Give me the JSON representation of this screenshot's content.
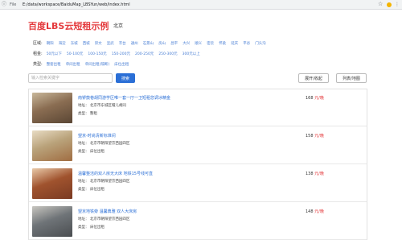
{
  "browser": {
    "file_label": "File",
    "url": "E:/data/workspace/BaiduMap_LBSYun/web/index.html"
  },
  "header": {
    "title": "百度LBS云短租示例",
    "city": "北京"
  },
  "filters": {
    "district": {
      "label": "区域:",
      "options": [
        "朝阳",
        "海淀",
        "东城",
        "西城",
        "崇文",
        "宣武",
        "丰台",
        "通州",
        "石景山",
        "房山",
        "昌平",
        "大兴",
        "顺义",
        "密云",
        "怀柔",
        "延庆",
        "平谷",
        "门头沟"
      ]
    },
    "rent": {
      "label": "租金:",
      "options": [
        "50元以下",
        "50-100元",
        "100-150元",
        "150-200元",
        "200-250元",
        "250-300元",
        "300元以上"
      ]
    },
    "type": {
      "label": "类型:",
      "options": [
        "整套出租",
        "单间出租",
        "单间出租(隔断)",
        "床位出租"
      ]
    }
  },
  "search": {
    "placeholder": "输入检索关键字",
    "button": "搜索",
    "toggle": "展开/收起",
    "list_map": "列表/地图"
  },
  "listings": [
    {
      "title": "南锣鼓巷胡同游学区唯一套一厅一卫短租您调冰精金",
      "address": "地址：  北京市东城区帽儿胡同",
      "type": "类型：  整租",
      "price": "168",
      "unit": "元/晚",
      "thumb_colors": [
        "#8a6d52",
        "#c9b89b",
        "#5a4634"
      ]
    },
    {
      "title": "望京-时尚清新标准间",
      "address": "地址：  北京市朝阳望京西园四区",
      "type": "类型：  床位出租",
      "price": "158",
      "unit": "元/晚",
      "thumb_colors": [
        "#b9a27a",
        "#e8dcc4",
        "#a06d42"
      ]
    },
    {
      "title": "温馨整洁的双人房无大床 地铁15号线可直",
      "address": "地址：  北京市朝阳望京西园四区",
      "type": "类型：  床位出租",
      "price": "138",
      "unit": "元/晚",
      "thumb_colors": [
        "#a0532e",
        "#e9c9a8",
        "#7a3a22"
      ]
    },
    {
      "title": "望京地铁旁 温馨典雅 双人大床房",
      "address": "地址：  北京市朝阳望京西园四区",
      "type": "类型：  床位出租",
      "price": "148",
      "unit": "元/晚",
      "thumb_colors": [
        "#6f7478",
        "#c8c6c0",
        "#4a4d50"
      ]
    }
  ]
}
